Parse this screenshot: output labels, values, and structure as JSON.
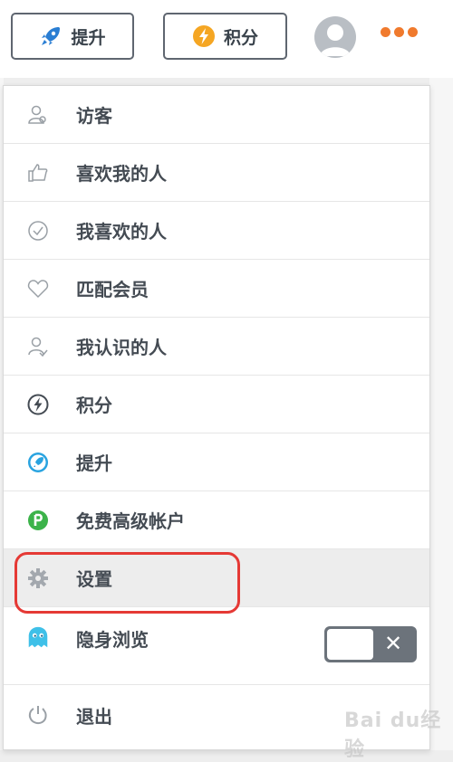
{
  "header": {
    "boost_label": "提升",
    "points_label": "积分",
    "boost_icon": "rocket-icon",
    "points_icon": "bolt-icon",
    "avatar_icon": "user-avatar",
    "more_icon": "more-dots-icon",
    "accent_color": "#f07a2d"
  },
  "menu": {
    "items": [
      {
        "label": "访客",
        "icon": "visitors-icon"
      },
      {
        "label": "喜欢我的人",
        "icon": "thumbs-up-icon"
      },
      {
        "label": "我喜欢的人",
        "icon": "check-circle-icon"
      },
      {
        "label": "匹配会员",
        "icon": "heart-icon"
      },
      {
        "label": "我认识的人",
        "icon": "people-check-icon"
      },
      {
        "label": "积分",
        "icon": "bolt-circle-icon"
      },
      {
        "label": "提升",
        "icon": "rocket-circle-icon"
      },
      {
        "label": "免费高级帐户",
        "icon": "premium-p-icon"
      },
      {
        "label": "设置",
        "icon": "gear-icon",
        "highlighted": true
      },
      {
        "label": "隐身浏览",
        "icon": "ghost-icon",
        "toggle": false
      },
      {
        "label": "退出",
        "icon": "power-icon"
      }
    ]
  },
  "watermark": "Bai du经验"
}
